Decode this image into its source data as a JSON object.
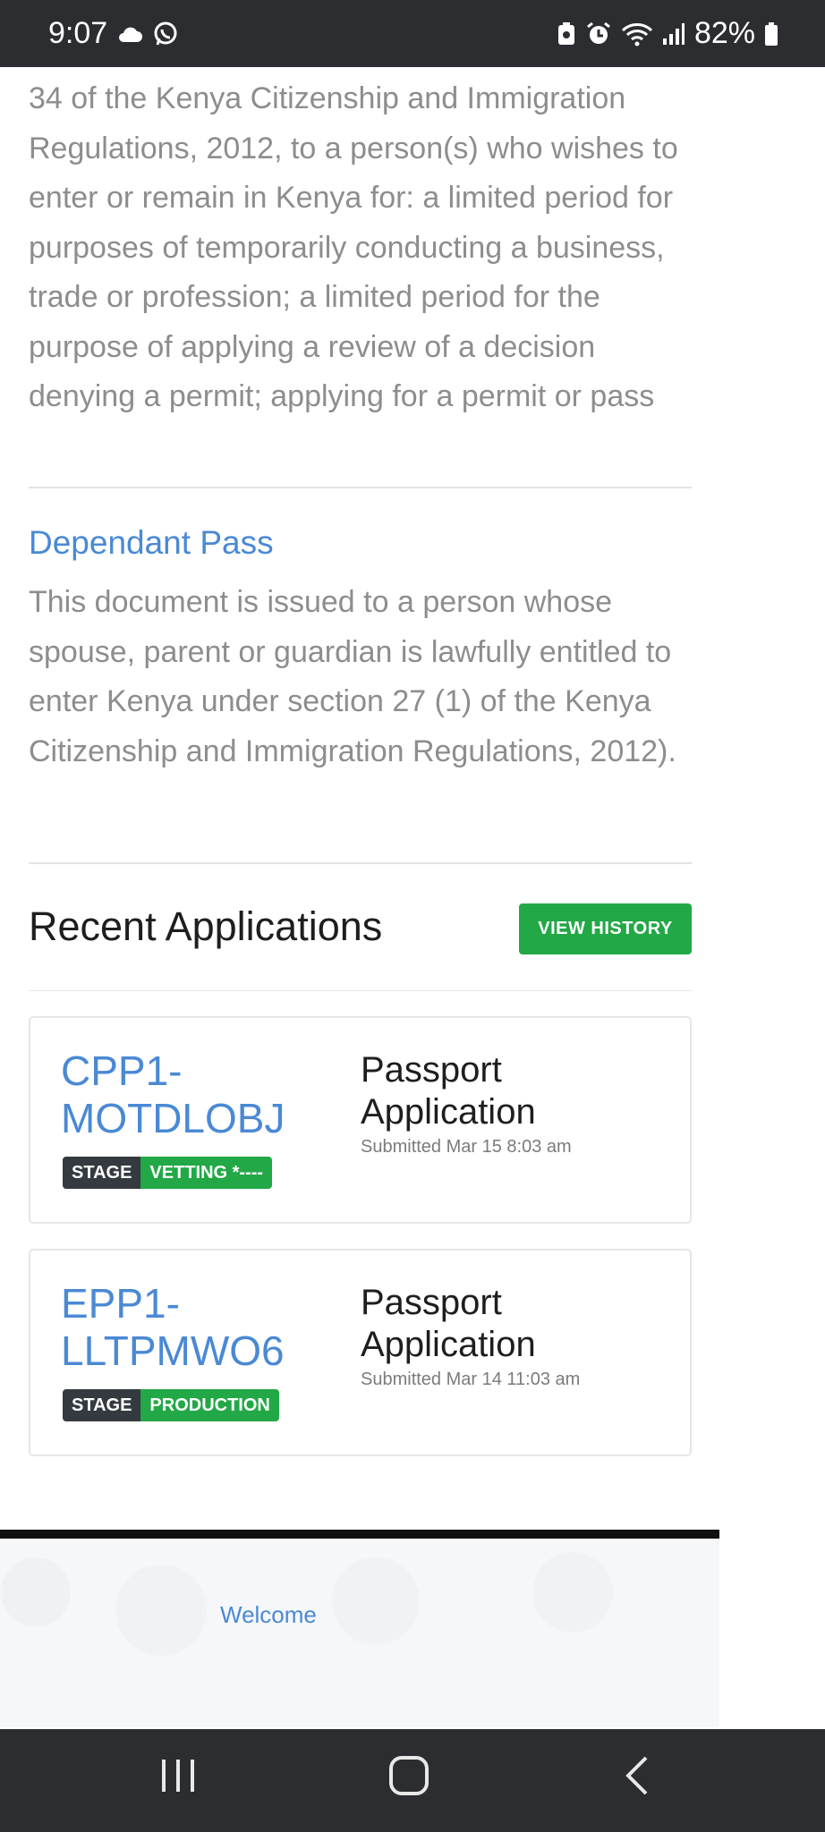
{
  "status_bar": {
    "time": "9:07",
    "battery": "82%",
    "icons": [
      "cloud-icon",
      "whatsapp-icon",
      "battery-saver-icon",
      "alarm-icon",
      "wifi-icon",
      "signal-icon",
      "battery-icon"
    ]
  },
  "intro_text": "34 of the Kenya Citizenship and Immigration Regulations, 2012, to a person(s) who wishes to enter or remain in Kenya for: a limited period for purposes of temporarily conducting a business, trade or profession; a limited period for the purpose of applying a review of a decision denying a permit; applying for a permit or pass",
  "dependant_pass": {
    "title": "Dependant Pass",
    "description": "This document is issued to a person whose spouse, parent or guardian is lawfully entitled to enter Kenya under section 27 (1) of the Kenya Citizenship and Immigration Regulations, 2012)."
  },
  "recent": {
    "title": "Recent Applications",
    "view_history_label": "VIEW HISTORY",
    "applications": [
      {
        "id_line1": "CPP1-",
        "id_line2": "MOTDLOBJ",
        "stage_label": "STAGE",
        "stage_value": "VETTING *----",
        "type_line1": "Passport",
        "type_line2": "Application",
        "submitted": "Submitted Mar 15 8:03 am"
      },
      {
        "id_line1": "EPP1-",
        "id_line2": "LLTPMWO6",
        "stage_label": "STAGE",
        "stage_value": "PRODUCTION",
        "type_line1": "Passport",
        "type_line2": "Application",
        "submitted": "Submitted Mar 14 11:03 am"
      }
    ]
  },
  "footer": {
    "welcome": "Welcome"
  },
  "nav": {
    "icons": [
      "recents-icon",
      "home-icon",
      "back-icon"
    ]
  },
  "colors": {
    "link_blue": "#4a89d4",
    "success_green": "#22a846",
    "dark_badge": "#343a40",
    "system_bar": "#2c2d31"
  }
}
